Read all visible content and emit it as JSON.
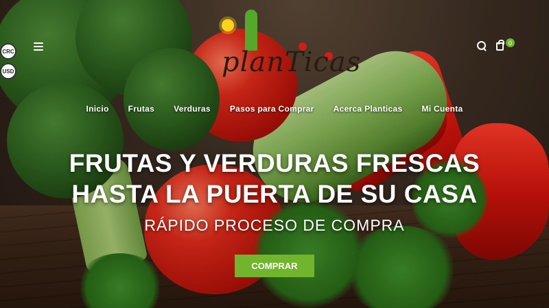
{
  "currency": {
    "crc": "CRC",
    "usd": "USD"
  },
  "header": {
    "logo_text": "planTicas",
    "cart_count": "0"
  },
  "nav": {
    "items": [
      {
        "label": "Inicio"
      },
      {
        "label": "Frutas"
      },
      {
        "label": "Verduras"
      },
      {
        "label": "Pasos para Comprar"
      },
      {
        "label": "Acerca Planticas"
      },
      {
        "label": "Mi Cuenta"
      }
    ]
  },
  "hero": {
    "title_line1": "FRUTAS Y VERDURAS FRESCAS",
    "title_line2": "HASTA LA PUERTA DE SU CASA",
    "subtitle": "RÁPIDO PROCESO DE COMPRA",
    "cta_label": "COMPRAR"
  },
  "colors": {
    "accent": "#71b52d",
    "text": "#ffffff"
  },
  "icons": [
    "menu-icon",
    "search-icon",
    "cart-icon"
  ]
}
